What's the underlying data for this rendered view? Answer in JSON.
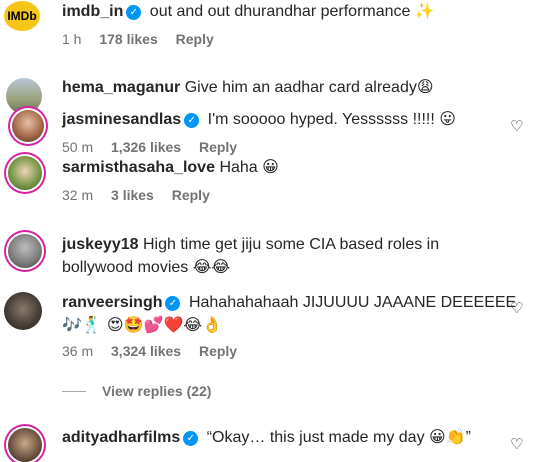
{
  "comments": [
    {
      "username": "imdb_in",
      "verified": true,
      "text": "out and out dhurandhar performance",
      "emoji": "✨",
      "time": "1 h",
      "likes": "178 likes",
      "reply": "Reply",
      "logo_text": "IMDb"
    },
    {
      "username": "hema_maganur",
      "verified": false,
      "text": "Give him an aadhar card already",
      "emoji": "😩"
    },
    {
      "username": "jasminesandlas",
      "verified": true,
      "text": "I'm sooooo hyped. Yessssss !!!!!",
      "emoji": "😛",
      "time": "50 m",
      "likes": "1,326 likes",
      "reply": "Reply"
    },
    {
      "username": "sarmisthasaha_love",
      "verified": false,
      "text": "Haha",
      "emoji": "😀",
      "time": "32 m",
      "likes": "3 likes",
      "reply": "Reply"
    },
    {
      "username": "juskeyy18",
      "verified": false,
      "text": "High time get jiju some CIA based roles in",
      "text2": "bollywood movies",
      "emoji": "😂😂"
    },
    {
      "username": "ranveersingh",
      "verified": true,
      "text": "Hahahahahaah JIJUUUU JAAANE DEEEEEE",
      "emoji2": "🎶🕺 😍🤩💕❤️😂👌",
      "time": "36 m",
      "likes": "3,324 likes",
      "reply": "Reply"
    },
    {
      "username": "adityadharfilms",
      "verified": true,
      "text": "“Okay… this just made my day",
      "emoji": "😀👏",
      "tail": "”"
    }
  ],
  "view_replies": "View replies (22)",
  "icons": {
    "heart": "heart-icon",
    "verified": "verified-badge-icon"
  },
  "colors": {
    "verified": "#0095f6",
    "imdb": "#f5c518",
    "story_ring": "#d6249f"
  }
}
